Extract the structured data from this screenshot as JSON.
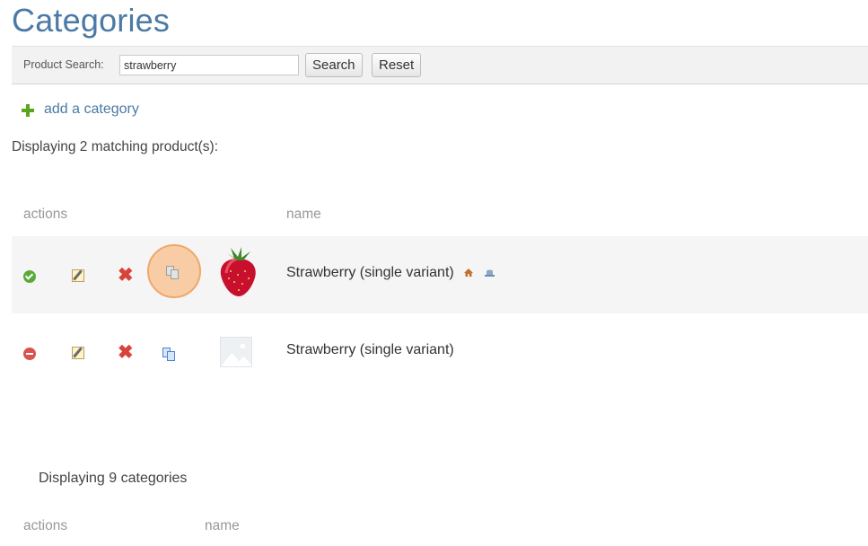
{
  "page_title": "Categories",
  "search": {
    "label": "Product Search:",
    "value": "strawberry",
    "search_button": "Search",
    "reset_button": "Reset"
  },
  "add_category_label": "add a category",
  "matching_text": "Displaying 2 matching product(s):",
  "products_table": {
    "columns": [
      "actions",
      "name"
    ],
    "rows": [
      {
        "status_icon": "active-check-icon",
        "name": "Strawberry (single variant)",
        "thumbnail": "strawberry-image",
        "extra_icons": [
          "home-icon",
          "hat-icon"
        ],
        "highlighted_action": "copy",
        "colors": {
          "status": "#5aaa3a",
          "highlight": "#f8cda6"
        }
      },
      {
        "status_icon": "inactive-minus-icon",
        "name": "Strawberry (single variant)",
        "thumbnail": "image-placeholder",
        "extra_icons": [],
        "colors": {
          "status": "#d9534f"
        }
      }
    ]
  },
  "categories_text": "Displaying 9 categories",
  "categories_table": {
    "columns": [
      "actions",
      "name"
    ]
  },
  "colors": {
    "title": "#4a7aa5",
    "link": "#4a7aa5",
    "add_icon": "#5aa51f",
    "delete_icon": "#d9443a"
  }
}
